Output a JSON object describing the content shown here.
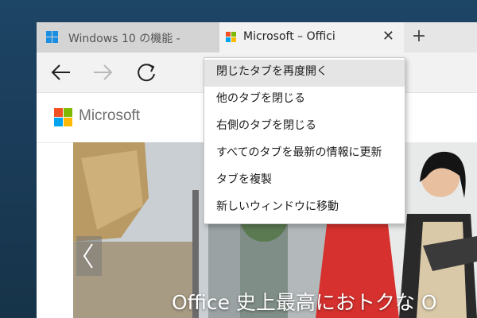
{
  "browser": {
    "tabs": [
      {
        "title": "Windows 10 の機能 - ",
        "icon": "windows-logo-icon",
        "active": false
      },
      {
        "title": "Microsoft – Offici",
        "icon": "microsoft-logo-icon",
        "active": true
      }
    ],
    "tab_close_glyph": "✕",
    "new_tab_glyph": "+",
    "nav": {
      "back_icon": "back-arrow-icon",
      "forward_icon": "forward-arrow-icon",
      "refresh_icon": "refresh-icon"
    }
  },
  "page": {
    "brand_name": "Microsoft",
    "hero_caption": "Office 史上最高におトクな O",
    "hero_prev_icon": "chevron-left-icon"
  },
  "context_menu": {
    "items": [
      {
        "label": "閉じたタブを再度開く",
        "highlighted": true
      },
      {
        "label": "他のタブを閉じる",
        "highlighted": false
      },
      {
        "label": "右側のタブを閉じる",
        "highlighted": false
      },
      {
        "label": "すべてのタブを最新の情報に更新",
        "highlighted": false
      },
      {
        "label": "タブを複製",
        "highlighted": false
      },
      {
        "label": "新しいウィンドウに移動",
        "highlighted": false
      }
    ]
  },
  "colors": {
    "desktop": "#1b3d5b",
    "menu_highlight": "#e5e5e5",
    "windows_blue": "#1a8ee0",
    "ms_red": "#f25022",
    "ms_green": "#7fba00",
    "ms_blue": "#00a4ef",
    "ms_yellow": "#ffb900"
  }
}
